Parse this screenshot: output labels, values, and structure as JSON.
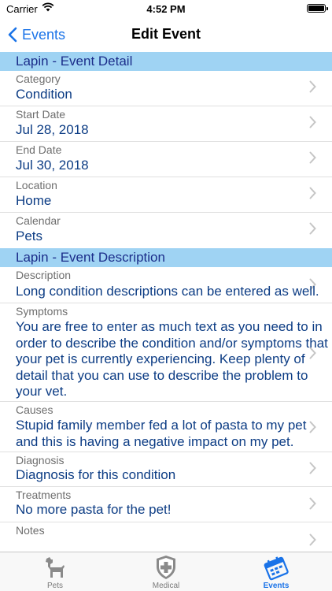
{
  "status_bar": {
    "carrier": "Carrier",
    "time": "4:52 PM"
  },
  "nav": {
    "back_label": "Events",
    "title": "Edit Event"
  },
  "sections": {
    "detail_title": "Lapin - Event Detail",
    "description_title": "Lapin - Event Description"
  },
  "detail_rows": [
    {
      "label": "Category",
      "value": "Condition"
    },
    {
      "label": "Start Date",
      "value": "Jul 28, 2018"
    },
    {
      "label": "End Date",
      "value": "Jul 30, 2018"
    },
    {
      "label": "Location",
      "value": "Home"
    },
    {
      "label": "Calendar",
      "value": "Pets"
    }
  ],
  "description_rows": [
    {
      "label": "Description",
      "value": "Long condition descriptions can be entered as well."
    },
    {
      "label": "Symptoms",
      "value": "You are free to enter as much text as you need to in order to describe the condition and/or symptoms that your pet is currently experiencing. Keep plenty of detail that you can use to describe the problem to your vet."
    },
    {
      "label": "Causes",
      "value": "Stupid family member fed a lot of pasta to my pet and this is having a negative impact on my pet."
    },
    {
      "label": "Diagnosis",
      "value": "Diagnosis for this condition"
    },
    {
      "label": "Treatments",
      "value": "No more pasta for the pet!"
    },
    {
      "label": "Notes",
      "value": ""
    }
  ],
  "tabs": [
    {
      "label": "Pets",
      "icon": "dog-icon",
      "active": false
    },
    {
      "label": "Medical",
      "icon": "medical-shield-icon",
      "active": false
    },
    {
      "label": "Events",
      "icon": "calendar-icon",
      "active": true
    }
  ],
  "colors": {
    "section_bg": "#9fd3f3",
    "section_text": "#1b2d8a",
    "value_text": "#0c3c84",
    "accent": "#1a73e8"
  }
}
